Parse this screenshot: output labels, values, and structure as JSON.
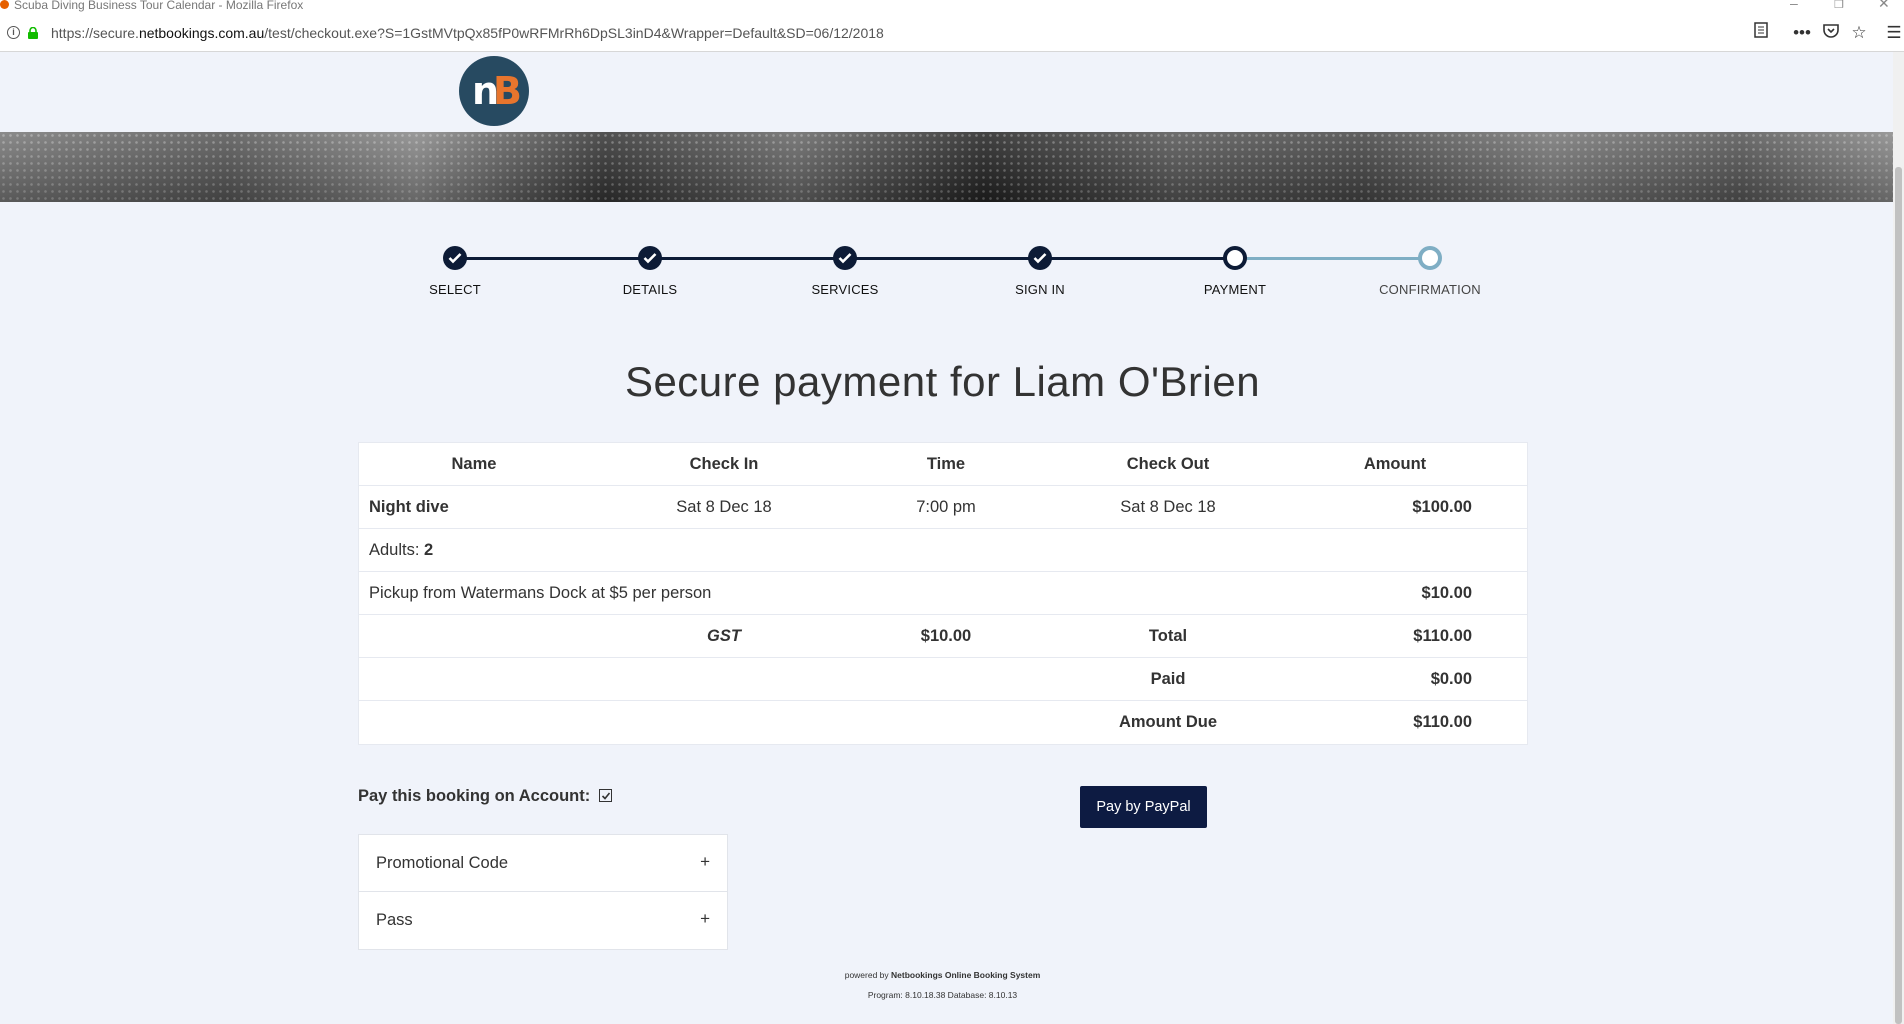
{
  "browser": {
    "window_title": "Scuba Diving Business Tour Calendar - Mozilla Firefox",
    "url_prefix": "https://secure.",
    "url_domain": "netbookings.com.au",
    "url_path": "/test/checkout.exe?S=1GstMVtpQx85fP0wRFMrRh6DpSL3inD4&Wrapper=Default&SD=06/12/2018"
  },
  "logo": {
    "letter_n": "n",
    "letter_b": "B"
  },
  "stepper": {
    "steps": [
      {
        "label": "SELECT",
        "state": "done"
      },
      {
        "label": "DETAILS",
        "state": "done"
      },
      {
        "label": "SERVICES",
        "state": "done"
      },
      {
        "label": "SIGN IN",
        "state": "done"
      },
      {
        "label": "PAYMENT",
        "state": "current"
      },
      {
        "label": "CONFIRMATION",
        "state": "future"
      }
    ],
    "colors": {
      "done": "#0d1b36",
      "future": "#7faec4"
    }
  },
  "page_title": "Secure payment for Liam O'Brien",
  "table": {
    "headers": {
      "name": "Name",
      "check_in": "Check In",
      "time": "Time",
      "check_out": "Check Out",
      "amount": "Amount"
    },
    "item": {
      "name": "Night dive",
      "check_in": "Sat 8 Dec 18",
      "time": "7:00 pm",
      "check_out": "Sat 8 Dec 18",
      "amount": "$100.00"
    },
    "adults": {
      "label": "Adults:",
      "value": "2"
    },
    "extra": {
      "label": "Pickup from Watermans Dock at $5 per person",
      "amount": "$10.00"
    },
    "gst": {
      "label": "GST",
      "value": "$10.00",
      "total_label": "Total",
      "total_value": "$110.00"
    },
    "paid": {
      "label": "Paid",
      "value": "$0.00"
    },
    "due": {
      "label": "Amount Due",
      "value": "$110.00"
    }
  },
  "account": {
    "label": "Pay this booking on Account:",
    "checked": true
  },
  "paypal_button": "Pay by PayPal",
  "accordion": [
    {
      "label": "Promotional Code",
      "toggle": "+"
    },
    {
      "label": "Pass",
      "toggle": "+"
    }
  ],
  "footer": {
    "powered_prefix": "powered by ",
    "powered_name": "Netbookings Online Booking System",
    "version": "Program: 8.10.18.38 Database: 8.10.13"
  },
  "colors": {
    "accent": "#0d1b42",
    "background": "#f0f3fa"
  }
}
